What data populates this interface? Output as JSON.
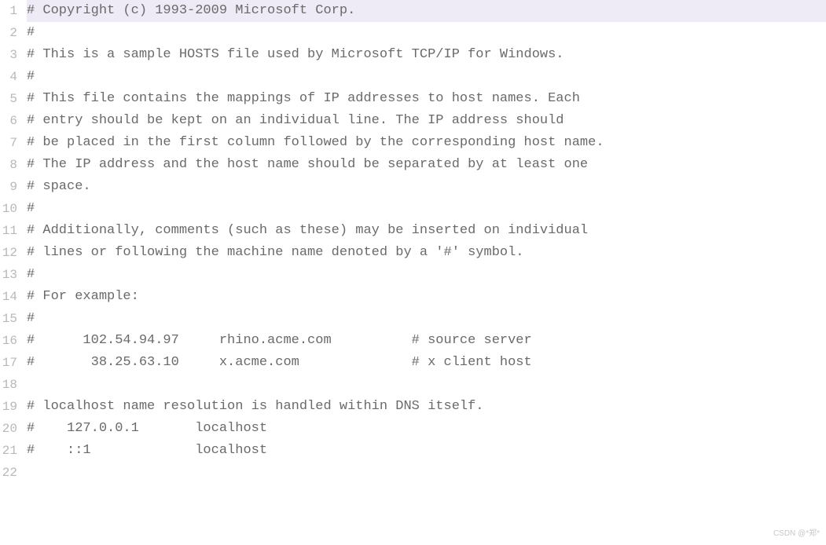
{
  "editor": {
    "highlighted_line": 1,
    "lines": [
      "# Copyright (c) 1993-2009 Microsoft Corp.",
      "#",
      "# This is a sample HOSTS file used by Microsoft TCP/IP for Windows.",
      "#",
      "# This file contains the mappings of IP addresses to host names. Each",
      "# entry should be kept on an individual line. The IP address should",
      "# be placed in the first column followed by the corresponding host name.",
      "# The IP address and the host name should be separated by at least one",
      "# space.",
      "#",
      "# Additionally, comments (such as these) may be inserted on individual",
      "# lines or following the machine name denoted by a '#' symbol.",
      "#",
      "# For example:",
      "#",
      "#      102.54.94.97     rhino.acme.com          # source server",
      "#       38.25.63.10     x.acme.com              # x client host",
      "",
      "# localhost name resolution is handled within DNS itself.",
      "#    127.0.0.1       localhost",
      "#    ::1             localhost",
      ""
    ]
  },
  "watermark": "CSDN @*郑*"
}
